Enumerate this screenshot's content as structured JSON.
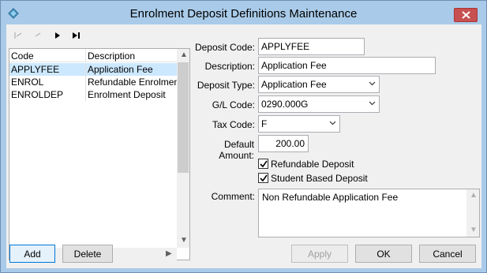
{
  "window": {
    "title": "Enrolment Deposit Definitions Maintenance"
  },
  "toolbar": {
    "icons": [
      "first-record-icon",
      "previous-record-icon",
      "next-record-icon",
      "last-record-icon"
    ]
  },
  "list": {
    "columns": [
      "Code",
      "Description"
    ],
    "rows": [
      {
        "code": "APPLYFEE",
        "description": "Application Fee",
        "selected": true
      },
      {
        "code": "ENROL",
        "description": "Refundable Enrolment Deposit",
        "selected": false
      },
      {
        "code": "ENROLDEP",
        "description": "Enrolment Deposit",
        "selected": false
      }
    ]
  },
  "form": {
    "deposit_code": {
      "label": "Deposit Code:",
      "value": "APPLYFEE"
    },
    "description": {
      "label": "Description:",
      "value": "Application Fee"
    },
    "deposit_type": {
      "label": "Deposit Type:",
      "value": "Application Fee"
    },
    "gl_code": {
      "label": "G/L Code:",
      "value": "0290.000G"
    },
    "tax_code": {
      "label": "Tax Code:",
      "value": "F"
    },
    "default_amount": {
      "label": "Default Amount:",
      "value": "200.00"
    },
    "refundable_deposit": {
      "label": "Refundable Deposit",
      "checked": true
    },
    "student_based_deposit": {
      "label": "Student Based Deposit",
      "checked": true
    },
    "comment": {
      "label": "Comment:",
      "value": "Non Refundable Application Fee"
    }
  },
  "buttons": {
    "add": "Add",
    "delete": "Delete",
    "apply": "Apply",
    "ok": "OK",
    "cancel": "Cancel"
  },
  "colors": {
    "title_bar": "#a9cbe9",
    "close": "#c75050",
    "selection": "#cce8ff"
  }
}
